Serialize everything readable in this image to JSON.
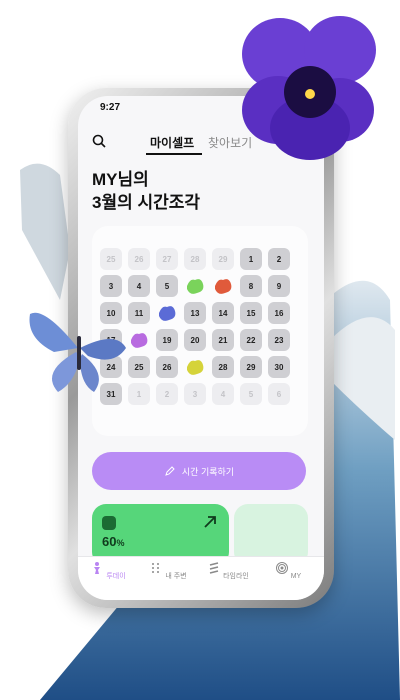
{
  "status": {
    "time": "9:27"
  },
  "tabs": [
    {
      "label": "마이셀프",
      "active": true
    },
    {
      "label": "찾아보기",
      "active": false
    }
  ],
  "headline": {
    "line1": "MY님의",
    "line2": "3월의 시간조각"
  },
  "calendar": {
    "days": [
      {
        "d": "25",
        "type": "other"
      },
      {
        "d": "26",
        "type": "other"
      },
      {
        "d": "27",
        "type": "other"
      },
      {
        "d": "28",
        "type": "other"
      },
      {
        "d": "29",
        "type": "other"
      },
      {
        "d": "1",
        "type": "cur"
      },
      {
        "d": "2",
        "type": "cur"
      },
      {
        "d": "3",
        "type": "cur"
      },
      {
        "d": "4",
        "type": "cur"
      },
      {
        "d": "5",
        "type": "cur"
      },
      {
        "d": "",
        "type": "mark",
        "mark": "green-blob"
      },
      {
        "d": "",
        "type": "mark",
        "mark": "sun-red"
      },
      {
        "d": "8",
        "type": "cur"
      },
      {
        "d": "9",
        "type": "cur"
      },
      {
        "d": "10",
        "type": "cur"
      },
      {
        "d": "11",
        "type": "cur"
      },
      {
        "d": "",
        "type": "mark",
        "mark": "blue-scribble"
      },
      {
        "d": "13",
        "type": "cur"
      },
      {
        "d": "14",
        "type": "cur"
      },
      {
        "d": "15",
        "type": "cur"
      },
      {
        "d": "16",
        "type": "cur"
      },
      {
        "d": "17",
        "type": "cur"
      },
      {
        "d": "",
        "type": "mark",
        "mark": "purple-blob"
      },
      {
        "d": "19",
        "type": "cur"
      },
      {
        "d": "20",
        "type": "cur"
      },
      {
        "d": "21",
        "type": "cur"
      },
      {
        "d": "22",
        "type": "cur"
      },
      {
        "d": "23",
        "type": "cur"
      },
      {
        "d": "24",
        "type": "cur"
      },
      {
        "d": "25",
        "type": "cur"
      },
      {
        "d": "26",
        "type": "cur"
      },
      {
        "d": "",
        "type": "mark",
        "mark": "yellow-wave"
      },
      {
        "d": "28",
        "type": "cur"
      },
      {
        "d": "29",
        "type": "cur"
      },
      {
        "d": "30",
        "type": "cur"
      },
      {
        "d": "31",
        "type": "cur"
      },
      {
        "d": "1",
        "type": "other"
      },
      {
        "d": "2",
        "type": "other"
      },
      {
        "d": "3",
        "type": "other"
      },
      {
        "d": "4",
        "type": "other"
      },
      {
        "d": "5",
        "type": "other"
      },
      {
        "d": "6",
        "type": "other"
      }
    ]
  },
  "record_button": {
    "label": "시간 기록하기",
    "icon": "pencil-icon"
  },
  "stat_card": {
    "percent": "60",
    "unit": "%",
    "icon": "coffee-icon",
    "arrow": "arrow-up-right-icon"
  },
  "nav": [
    {
      "label": "투데이",
      "icon": "figure-icon",
      "active": true
    },
    {
      "label": "내 주변",
      "icon": "dots-icon",
      "active": false
    },
    {
      "label": "타임라인",
      "icon": "timeline-icon",
      "active": false
    },
    {
      "label": "MY",
      "icon": "target-icon",
      "active": false
    }
  ],
  "colors": {
    "accent": "#b98cf5",
    "green": "#56d67a",
    "active_nav": "#b985f2"
  }
}
